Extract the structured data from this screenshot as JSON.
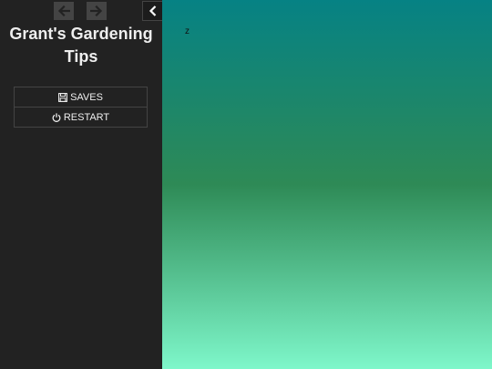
{
  "sidebar": {
    "title": "Grant's Gardening Tips",
    "menu": [
      {
        "label": "SAVES",
        "icon": "save-icon"
      },
      {
        "label": "RESTART",
        "icon": "power-icon"
      }
    ],
    "history_buttons": [
      {
        "icon": "arrow-left-icon"
      },
      {
        "icon": "arrow-right-icon"
      }
    ],
    "toggle_icon": "chevron-left-icon"
  },
  "passage": {
    "text": "z"
  },
  "colors": {
    "sidebar_bg": "#222222",
    "gradient_top": "#068284",
    "gradient_mid": "#2e8a56",
    "gradient_bottom": "#7ef7ca"
  }
}
